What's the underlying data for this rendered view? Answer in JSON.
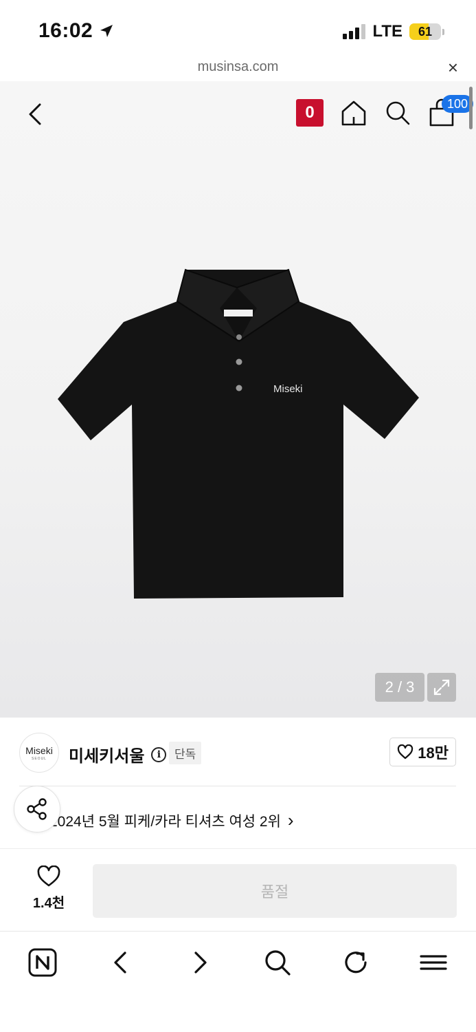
{
  "status_bar": {
    "time": "16:02",
    "network": "LTE",
    "battery": "61",
    "battery_level": 0.61,
    "signal_bars": 3,
    "icons": [
      "location-arrow-icon",
      "signal-icon",
      "battery-icon"
    ]
  },
  "url_bar": {
    "domain": "musinsa.com",
    "close_symbol": "×"
  },
  "header": {
    "brand_badge": "0",
    "cart_count": "100",
    "icons": [
      "back-icon",
      "home-icon",
      "search-icon",
      "cart-icon"
    ]
  },
  "product_image": {
    "logo_text": "Miseki",
    "pager": "2 / 3",
    "shirt_color": "#141414"
  },
  "brand": {
    "logo_main": "Miseki",
    "logo_sub": "SEOUL",
    "name": "미세키서울",
    "info_symbol": "i",
    "exclusive_label": "단독",
    "likes": "18만"
  },
  "ranking": {
    "text": "2024년 5월 피케/카라 티셔츠 여성 2위",
    "chevron": "›"
  },
  "actions": {
    "wish_count": "1.4천",
    "soldout_label": "품절"
  },
  "browser_nav": {
    "icons": [
      "naver-icon",
      "nav-back-icon",
      "nav-forward-icon",
      "nav-search-icon",
      "refresh-icon",
      "menu-icon"
    ]
  },
  "colors": {
    "brand_badge": "#c8102e",
    "cart_badge": "#1a73e8",
    "battery_fill": "#f5cf1b",
    "soldout_bg": "#efefef"
  }
}
